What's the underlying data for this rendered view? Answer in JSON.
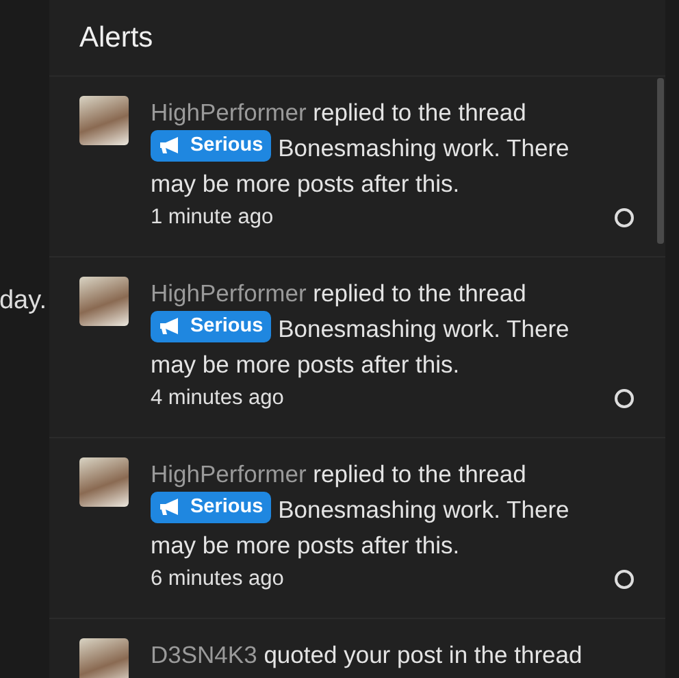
{
  "background": {
    "text": "day."
  },
  "panel": {
    "title": "Alerts"
  },
  "alerts": [
    {
      "user": "HighPerformer",
      "action": "replied to the thread",
      "prefix": "Serious",
      "thread": "Bonesmashing work. There may be more posts after this.",
      "time": "1 minute ago",
      "read": true
    },
    {
      "user": "HighPerformer",
      "action": "replied to the thread",
      "prefix": "Serious",
      "thread": "Bonesmashing work. There may be more posts after this.",
      "time": "4 minutes ago",
      "read": true
    },
    {
      "user": "HighPerformer",
      "action": "replied to the thread",
      "prefix": "Serious",
      "thread": "Bonesmashing work. There may be more posts after this.",
      "time": "6 minutes ago",
      "read": true
    },
    {
      "user": "D3SN4K3",
      "action": "quoted your post in the thread"
    }
  ]
}
